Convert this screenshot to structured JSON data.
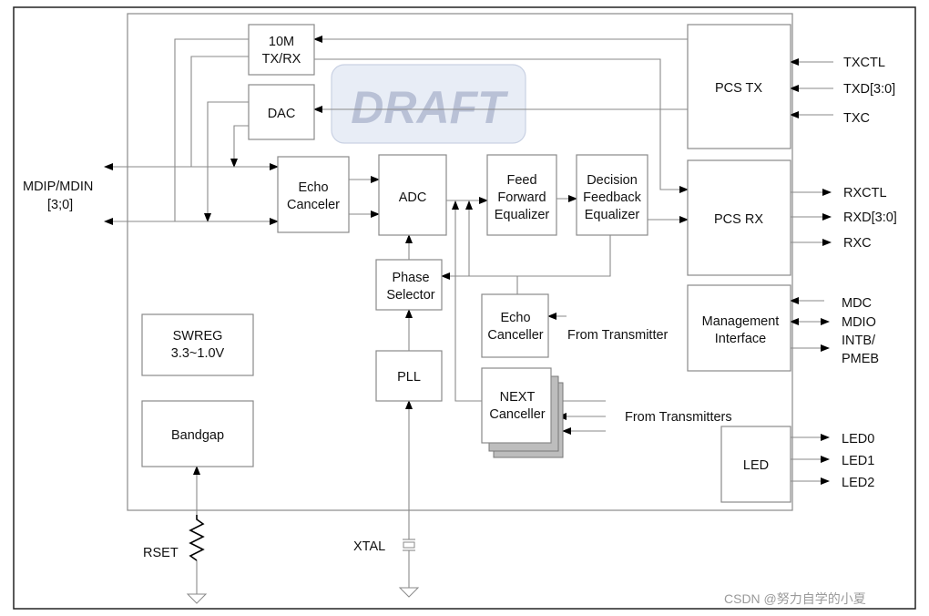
{
  "blocks": {
    "tenm_line1": "10M",
    "tenm_line2": "TX/RX",
    "dac": "DAC",
    "echo_canceler_1": "Echo",
    "echo_canceler_2": "Canceler",
    "adc": "ADC",
    "ffe_1": "Feed",
    "ffe_2": "Forward",
    "ffe_3": "Equalizer",
    "dfe_1": "Decision",
    "dfe_2": "Feedback",
    "dfe_3": "Equalizer",
    "pcs_tx": "PCS TX",
    "pcs_rx": "PCS RX",
    "mgmt_1": "Management",
    "mgmt_2": "Interface",
    "phase_1": "Phase",
    "phase_2": "Selector",
    "pll": "PLL",
    "echo_canceller_1": "Echo",
    "echo_canceller_2": "Canceller",
    "next_1": "NEXT",
    "next_2": "Canceller",
    "swreg_1": "SWREG",
    "swreg_2": "3.3~1.0V",
    "bandgap": "Bandgap",
    "led": "LED"
  },
  "signals": {
    "mdi_1": "MDIP/MDIN",
    "mdi_2": "[3;0]",
    "txctl": "TXCTL",
    "txd": "TXD[3:0]",
    "txc": "TXC",
    "rxctl": "RXCTL",
    "rxd": "RXD[3:0]",
    "rxc": "RXC",
    "mdc": "MDC",
    "mdio": "MDIO",
    "intb": "INTB/",
    "pmeb": "PMEB",
    "led0": "LED0",
    "led1": "LED1",
    "led2": "LED2",
    "from_transmitter": "From Transmitter",
    "from_transmitters": "From Transmitters",
    "rset": "RSET",
    "xtal": "XTAL"
  },
  "watermarks": {
    "draft": "DRAFT",
    "source": "CSDN @努力自学的小夏"
  },
  "colors": {
    "line": "#8a8a8a",
    "draft_fill": "#e8edf6",
    "draft_text": "#b9c1d6",
    "shadow": "#bdbdbd"
  }
}
